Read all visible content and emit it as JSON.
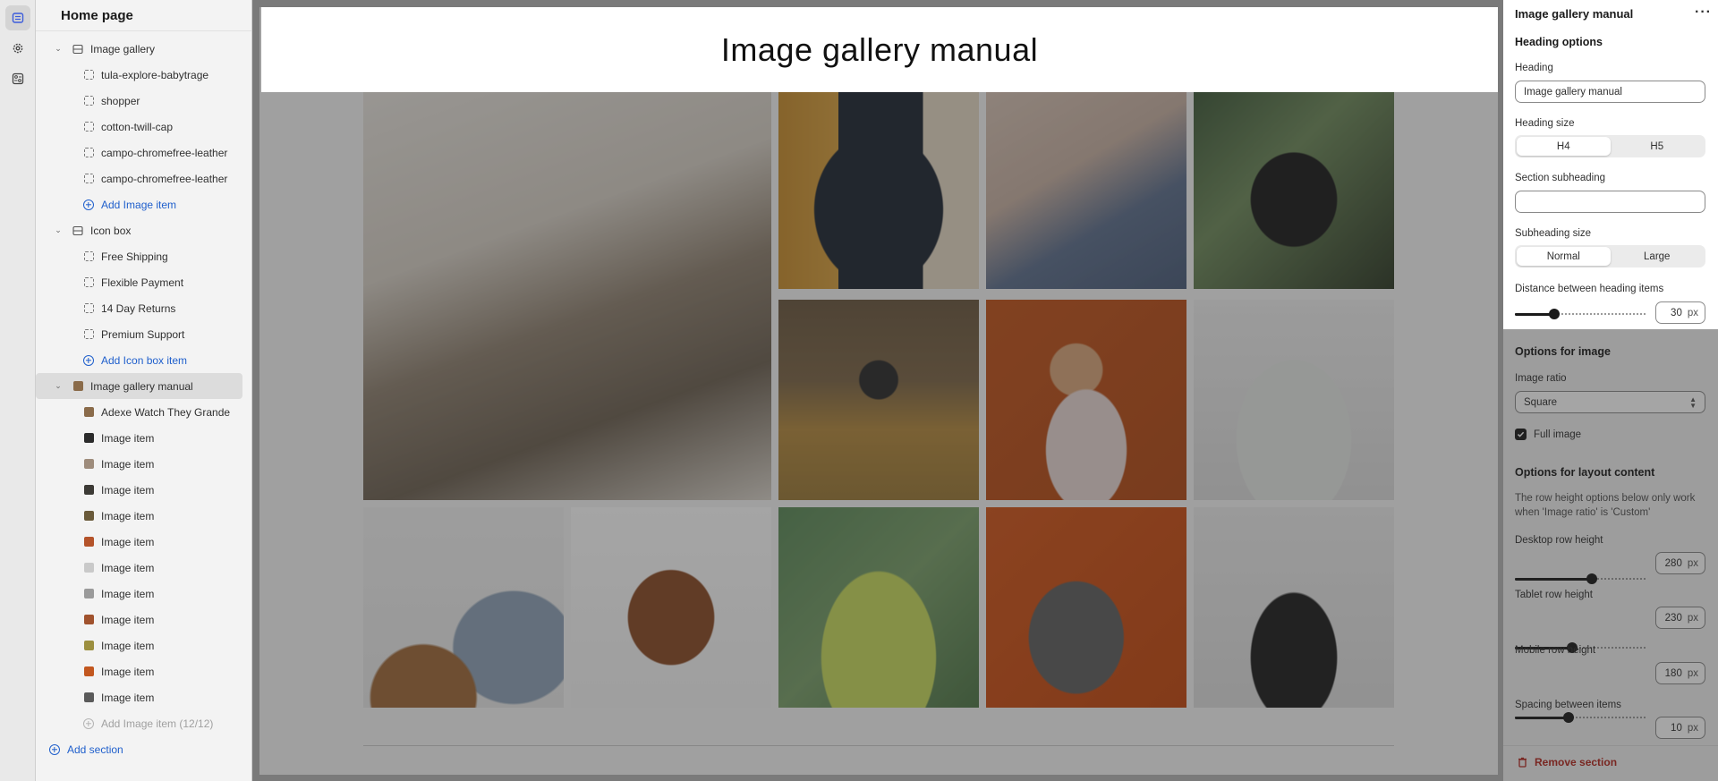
{
  "left_panel": {
    "title": "Home page",
    "items": [
      {
        "label": "Image gallery",
        "level": 1,
        "kind": "section",
        "icon": "gallery-icon"
      },
      {
        "label": "tula-explore-babytrage",
        "level": 2,
        "kind": "block"
      },
      {
        "label": "shopper",
        "level": 2,
        "kind": "block"
      },
      {
        "label": "cotton-twill-cap",
        "level": 2,
        "kind": "block"
      },
      {
        "label": "campo-chromefree-leather",
        "level": 2,
        "kind": "block"
      },
      {
        "label": "campo-chromefree-leather",
        "level": 2,
        "kind": "block"
      },
      {
        "label": "Add Image item",
        "level": 2,
        "kind": "add"
      },
      {
        "label": "Icon box",
        "level": 1,
        "kind": "section",
        "icon": "icon-box-icon"
      },
      {
        "label": "Free Shipping",
        "level": 2,
        "kind": "block"
      },
      {
        "label": "Flexible Payment",
        "level": 2,
        "kind": "block"
      },
      {
        "label": "14 Day Returns",
        "level": 2,
        "kind": "block"
      },
      {
        "label": "Premium Support",
        "level": 2,
        "kind": "block"
      },
      {
        "label": "Add Icon box item",
        "level": 2,
        "kind": "add"
      },
      {
        "label": "Image gallery manual",
        "level": 1,
        "kind": "section-selected",
        "icon": "image-thumb-icon"
      },
      {
        "label": "Adexe Watch They Grande",
        "level": 2,
        "kind": "thumb",
        "color": "#8a6b4a"
      },
      {
        "label": "Image item",
        "level": 2,
        "kind": "thumb",
        "color": "#2b2b2b"
      },
      {
        "label": "Image item",
        "level": 2,
        "kind": "thumb",
        "color": "#9e8c7c"
      },
      {
        "label": "Image item",
        "level": 2,
        "kind": "thumb",
        "color": "#3c3a35"
      },
      {
        "label": "Image item",
        "level": 2,
        "kind": "thumb",
        "color": "#6a5a3a"
      },
      {
        "label": "Image item",
        "level": 2,
        "kind": "thumb",
        "color": "#b4532a"
      },
      {
        "label": "Image item",
        "level": 2,
        "kind": "thumb",
        "color": "#c9c9c9"
      },
      {
        "label": "Image item",
        "level": 2,
        "kind": "thumb",
        "color": "#9a9a9a"
      },
      {
        "label": "Image item",
        "level": 2,
        "kind": "thumb",
        "color": "#a0522d"
      },
      {
        "label": "Image item",
        "level": 2,
        "kind": "thumb",
        "color": "#9c8f3f"
      },
      {
        "label": "Image item",
        "level": 2,
        "kind": "thumb",
        "color": "#c2571f"
      },
      {
        "label": "Image item",
        "level": 2,
        "kind": "thumb",
        "color": "#5a5a5a"
      },
      {
        "label": "Add Image item (12/12)",
        "level": 2,
        "kind": "add-disabled"
      },
      {
        "label": "Add section",
        "level": 0,
        "kind": "add"
      }
    ]
  },
  "preview": {
    "heading": "Image gallery manual",
    "photos": [
      {
        "name": "woman-blazer-photo",
        "bg": "linear-gradient(160deg,#e9e5df 0%,#d7d0c6 35%,#8f8170 55%,#6d6152 75%,#d9d3ca 100%)"
      },
      {
        "name": "bolt-tshirt-photo",
        "bg": "radial-gradient(ellipse at 50% 60%,#1e2733 0 45%,transparent 46%),linear-gradient(90deg,#c98e2e 0%,#d9a13f 30%,#1e2733 30%,#1e2733 72%,#e6d9c5 72%)"
      },
      {
        "name": "guitar-coffee-photo",
        "bg": "linear-gradient(150deg,#d8c4b6 0%,#c8b1a3 40%,#5d6f8d 65%,#4a5c7a 100%)"
      },
      {
        "name": "woman-plants-photo",
        "bg": "radial-gradient(ellipse at 50% 55%,#1b1b1b 0 30%,transparent 31%),linear-gradient(135deg,#3f5a3a 0%,#6f8b5c 40%,#2e3a26 100%)"
      },
      {
        "name": "camera-cornfield-photo",
        "bg": "radial-gradient(circle at 50% 40%,#2a2a2a 0 12%,transparent 13%),linear-gradient(180deg,#6b5840 0%,#7d6647 40%,#b58a3e 65%,#9c7a37 100%)"
      },
      {
        "name": "floral-top-photo",
        "bg": "radial-gradient(ellipse at 50% 75%,#e9d8d5 0 28%,transparent 29%),radial-gradient(circle at 45% 35%,#d9a57a 0 15%,transparent 16%),linear-gradient(135deg,#c2541b 0%,#b34a17 100%)"
      },
      {
        "name": "grey-sweater-photo",
        "bg": "radial-gradient(ellipse at 50% 70%,#e6e9e6 0 40%,transparent 41%),linear-gradient(180deg,#efefef 0%,#dcdcdc 100%)"
      },
      {
        "name": "tx-shirt-hat-photo",
        "bg": "radial-gradient(circle at 30% 95%,#a06a3a 0 22%,transparent 23%),radial-gradient(ellipse at 75% 70%,#8fa3b8 0 28%,transparent 29%),linear-gradient(180deg,#f2f2f2 0%,#e9e9e9 100%)"
      },
      {
        "name": "leather-backpack-photo",
        "bg": "radial-gradient(ellipse at 50% 55%,#8b4a25 0 30%,transparent 31%),linear-gradient(180deg,#ffffff 0%,#f4f4f4 100%)"
      },
      {
        "name": "green-sweater-photo",
        "bg": "radial-gradient(ellipse at 50% 75%,#c9db5e 0 40%,transparent 41%),linear-gradient(135deg,#5b8a59 0%,#7aa06a 50%,#4f7748 100%)"
      },
      {
        "name": "grey-tee-man-photo",
        "bg": "radial-gradient(ellipse at 45% 65%,#5f5f5f 0 30%,transparent 31%),linear-gradient(135deg,#d2561b 0%,#c4480f 100%)"
      },
      {
        "name": "black-jacket-photo",
        "bg": "radial-gradient(ellipse at 50% 75%,#1e1e1e 0 30%,transparent 31%),linear-gradient(180deg,#ececec 0%,#dedede 100%)"
      }
    ]
  },
  "right_panel": {
    "title": "Image gallery manual",
    "heading_options": "Heading options",
    "heading_label": "Heading",
    "heading_value": "Image gallery manual",
    "heading_size_label": "Heading size",
    "heading_size_options": [
      "H4",
      "H5"
    ],
    "heading_size_selected": "H4",
    "subheading_label": "Section subheading",
    "subheading_value": "",
    "subheading_size_label": "Subheading size",
    "subheading_size_options": [
      "Normal",
      "Large"
    ],
    "subheading_size_selected": "Normal",
    "distance_label": "Distance between heading items",
    "distance_value": "30",
    "distance_fraction": 0.3,
    "image_options": "Options for image",
    "image_ratio_label": "Image ratio",
    "image_ratio_value": "Square",
    "full_image_label": "Full image",
    "full_image_checked": true,
    "layout_options": "Options for layout content",
    "layout_note": "The row height options below only work when 'Image ratio' is 'Custom'",
    "desktop_row_label": "Desktop row height",
    "desktop_row_value": "280",
    "desktop_row_fraction": 0.59,
    "tablet_row_label": "Tablet row height",
    "tablet_row_value": "230",
    "tablet_row_fraction": 0.44,
    "mobile_row_label": "Mobile row height",
    "mobile_row_value": "180",
    "mobile_row_fraction": 0.41,
    "spacing_label": "Spacing between items",
    "spacing_value": "10",
    "spacing_fraction": 0.97,
    "unit": "px",
    "remove_label": "Remove section"
  }
}
